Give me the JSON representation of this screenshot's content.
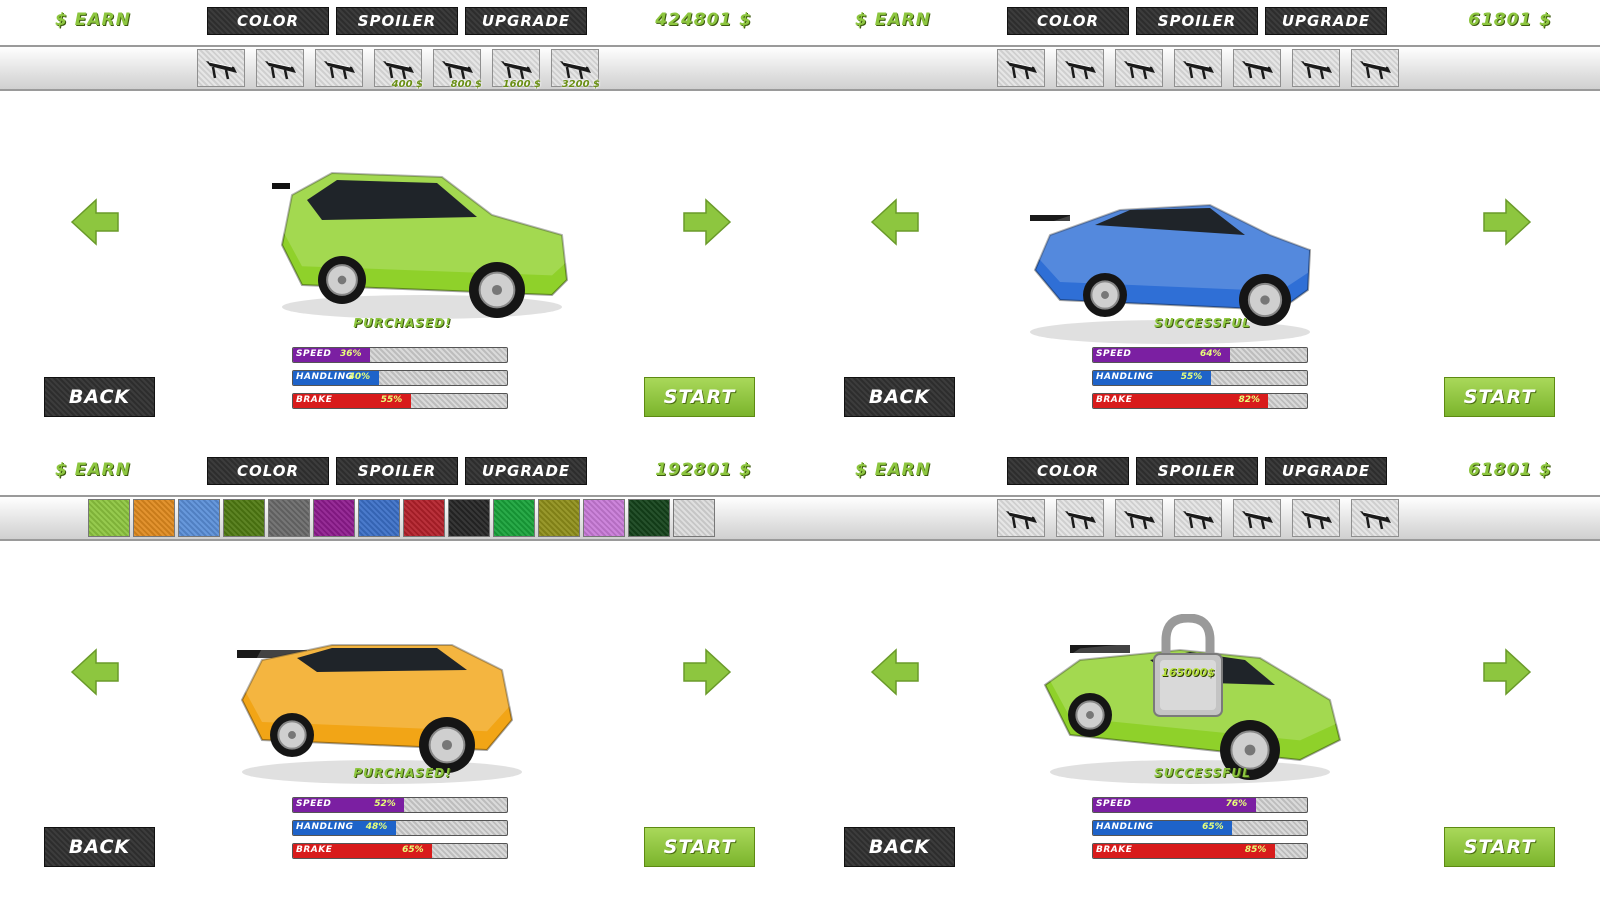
{
  "panels": [
    {
      "earn_label": "$ EARN",
      "money": "424801 $",
      "tabs": [
        "COLOR",
        "SPOILER",
        "UPGRADE"
      ],
      "strip": "spoiler",
      "spoilers": [
        {
          "price": ""
        },
        {
          "price": ""
        },
        {
          "price": ""
        },
        {
          "price": "400 $"
        },
        {
          "price": "800 $"
        },
        {
          "price": "1600 $"
        },
        {
          "price": "3200 $"
        }
      ],
      "car": {
        "type": "suv",
        "color": "#8fd12a"
      },
      "status": "PURCHASED!",
      "stats": [
        {
          "label": "SPEED",
          "value": "36%",
          "level": 36,
          "color": "#7b1fa2"
        },
        {
          "label": "HANDLING",
          "value": "40%",
          "level": 40,
          "color": "#1e63c9"
        },
        {
          "label": "BRAKE",
          "value": "55%",
          "level": 55,
          "color": "#d81b1b"
        }
      ],
      "back_label": "BACK",
      "start_label": "START",
      "locked": false
    },
    {
      "earn_label": "$ EARN",
      "money": "61801 $",
      "tabs": [
        "COLOR",
        "SPOILER",
        "UPGRADE"
      ],
      "strip": "spoiler",
      "spoilers": [
        {
          "price": ""
        },
        {
          "price": ""
        },
        {
          "price": ""
        },
        {
          "price": ""
        },
        {
          "price": ""
        },
        {
          "price": ""
        },
        {
          "price": ""
        }
      ],
      "car": {
        "type": "coupe",
        "color": "#2f6fd6"
      },
      "status": "SUCCESSFUL",
      "stats": [
        {
          "label": "SPEED",
          "value": "64%",
          "level": 64,
          "color": "#7b1fa2"
        },
        {
          "label": "HANDLING",
          "value": "55%",
          "level": 55,
          "color": "#1e63c9"
        },
        {
          "label": "BRAKE",
          "value": "82%",
          "level": 82,
          "color": "#d81b1b"
        }
      ],
      "back_label": "BACK",
      "start_label": "START",
      "locked": false
    },
    {
      "earn_label": "$ EARN",
      "money": "192801 $",
      "tabs": [
        "COLOR",
        "SPOILER",
        "UPGRADE"
      ],
      "strip": "color",
      "colors": [
        "#8dc63f",
        "#e08a1e",
        "#5a8fd8",
        "#4f7a12",
        "#6a6a6a",
        "#8e1b8e",
        "#3b6fc7",
        "#b3202a",
        "#262626",
        "#18a33a",
        "#8f8f1a",
        "#c97bd8",
        "#14421a",
        "#dcdcdc"
      ],
      "car": {
        "type": "muscle",
        "color": "#f2a516"
      },
      "status": "PURCHASED!",
      "stats": [
        {
          "label": "SPEED",
          "value": "52%",
          "level": 52,
          "color": "#7b1fa2"
        },
        {
          "label": "HANDLING",
          "value": "48%",
          "level": 48,
          "color": "#1e63c9"
        },
        {
          "label": "BRAKE",
          "value": "65%",
          "level": 65,
          "color": "#d81b1b"
        }
      ],
      "back_label": "BACK",
      "start_label": "START",
      "locked": false
    },
    {
      "earn_label": "$ EARN",
      "money": "61801 $",
      "tabs": [
        "COLOR",
        "SPOILER",
        "UPGRADE"
      ],
      "strip": "spoiler",
      "spoilers": [
        {
          "price": ""
        },
        {
          "price": ""
        },
        {
          "price": ""
        },
        {
          "price": ""
        },
        {
          "price": ""
        },
        {
          "price": ""
        },
        {
          "price": ""
        }
      ],
      "car": {
        "type": "sports",
        "color": "#8fd12a"
      },
      "status": "SUCCESSFUL",
      "stats": [
        {
          "label": "SPEED",
          "value": "76%",
          "level": 76,
          "color": "#7b1fa2"
        },
        {
          "label": "HANDLING",
          "value": "65%",
          "level": 65,
          "color": "#1e63c9"
        },
        {
          "label": "BRAKE",
          "value": "85%",
          "level": 85,
          "color": "#d81b1b"
        }
      ],
      "back_label": "BACK",
      "start_label": "START",
      "locked": true,
      "lock_price": "165000$"
    }
  ]
}
